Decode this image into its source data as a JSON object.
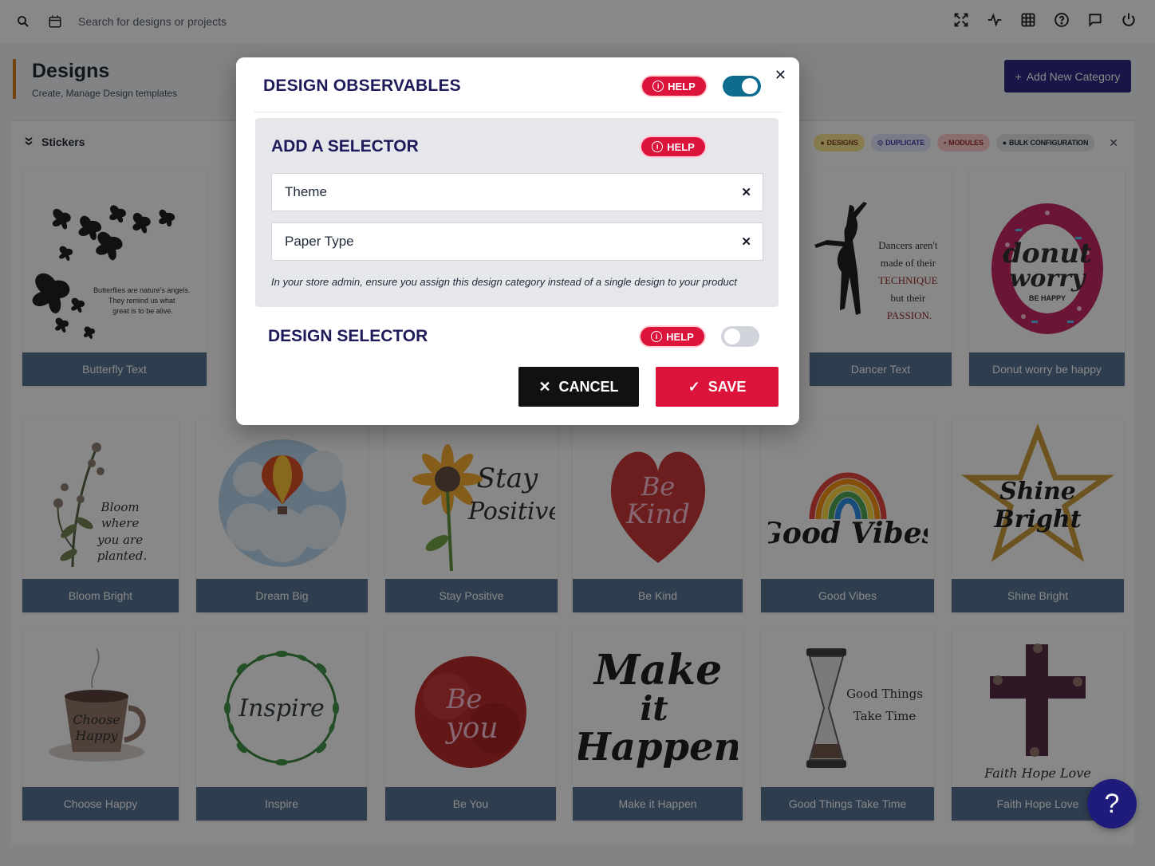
{
  "topbar": {
    "search_placeholder": "Search for designs or projects",
    "icons": [
      "search-icon",
      "calendar-icon",
      "fullscreen-icon",
      "activity-icon",
      "grid-icon",
      "help-circle-icon",
      "chat-icon",
      "power-icon"
    ]
  },
  "header": {
    "title": "Designs",
    "subtitle": "Create, Manage Design templates",
    "add_button": "Add New Category"
  },
  "category": {
    "title": "Stickers",
    "actions": {
      "designs": "DESIGNS",
      "duplicate": "DUPLICATE",
      "modules": "MODULES",
      "bulk": "BULK CONFIGURATION"
    }
  },
  "cards": {
    "row1": [
      "Butterfly Text",
      "Dancer Text",
      "Donut worry be happy"
    ],
    "row2": [
      "Bloom Bright",
      "Dream Big",
      "Stay Positive",
      "Be Kind",
      "Good Vibes",
      "Shine Bright"
    ],
    "row3": [
      "Choose Happy",
      "Inspire",
      "Be You",
      "Make it Happen",
      "Good Things Take Time",
      "Faith Hope Love"
    ]
  },
  "art": {
    "butterfly": "Butterflies are nature's angels. They remind us what great is to be alive.",
    "dancer": [
      "Dancers aren't",
      "made of their",
      "TECHNIQUE",
      "but their",
      "PASSION."
    ],
    "donut": [
      "donut",
      "worry",
      "BE HAPPY"
    ],
    "bloom": [
      "Bloom",
      "where",
      "you are",
      "planted."
    ],
    "stay": [
      "Stay",
      "Positive"
    ],
    "bekind": [
      "Be",
      "Kind"
    ],
    "goodvibes": "Good Vibes",
    "shine": [
      "Shine",
      "Bright"
    ],
    "choose": [
      "Choose",
      "Happy"
    ],
    "inspire": "Inspire",
    "beyou": [
      "Be",
      "you"
    ],
    "make": [
      "Make",
      "it",
      "Happen"
    ],
    "goodthings": [
      "Good Things",
      "Take Time"
    ],
    "faith": "Faith Hope Love"
  },
  "modal": {
    "title": "DESIGN OBSERVABLES",
    "help": "HELP",
    "observables_enabled": true,
    "selector": {
      "title": "ADD A SELECTOR",
      "inputs": [
        "Theme",
        "Paper Type"
      ],
      "note": "In your store admin, ensure you assign this design category instead of a single design to your product"
    },
    "design_selector": {
      "title": "DESIGN SELECTOR",
      "enabled": false
    },
    "cancel": "CANCEL",
    "save": "SAVE"
  },
  "help_fab": "?",
  "colors": {
    "brand_navy": "#1e1b7a",
    "accent_red": "#dc143c",
    "toggle_on": "#0e6d8f",
    "card_label": "#4b6a8d",
    "header_accent": "#d97706"
  }
}
